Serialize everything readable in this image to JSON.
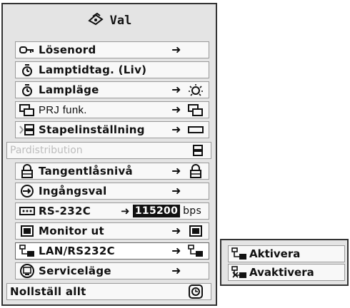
{
  "menu": {
    "title": "Val",
    "title_icon": "wrench-icon",
    "items": [
      {
        "label": "Lösenord",
        "icon": "key-icon",
        "arrow": "➜"
      },
      {
        "label": "Lamptidtag. (Liv)",
        "icon": "lamp-timer-icon"
      },
      {
        "label": "Lampläge",
        "icon": "lamp-timer-icon",
        "arrow": "➜"
      },
      {
        "label": "PRJ funk.",
        "icon": "prj-function-icon",
        "arrow": "➜"
      },
      {
        "label": "Stapelinställning",
        "icon": "stack-icon",
        "arrow": "➜"
      },
      {
        "label": "Pardistribution",
        "icon": "",
        "disabled": true
      },
      {
        "label": "Tangentlåsnivå",
        "icon": "padlock-icon",
        "arrow": "➜"
      },
      {
        "label": "Ingångsval",
        "icon": "input-select-icon",
        "arrow": "➜"
      },
      {
        "label": "RS-232C",
        "icon": "rs232c-port-icon",
        "arrow": "➜",
        "baud_value": "115200",
        "baud_unit": "bps"
      },
      {
        "label": "Monitor ut",
        "icon": "monitor-out-icon",
        "arrow": "➜"
      },
      {
        "label": "LAN/RS232C",
        "icon": "lan-icon",
        "arrow": "➜",
        "selected": true
      },
      {
        "label": "Serviceläge",
        "icon": "service-mode-icon",
        "arrow": "➜"
      },
      {
        "label": "Nollställ allt",
        "icon": "reset-icon"
      }
    ]
  },
  "submenu": {
    "items": [
      {
        "label": "Aktivera",
        "icon": "lan-enable-icon"
      },
      {
        "label": "Avaktivera",
        "icon": "lan-disable-icon"
      }
    ]
  }
}
